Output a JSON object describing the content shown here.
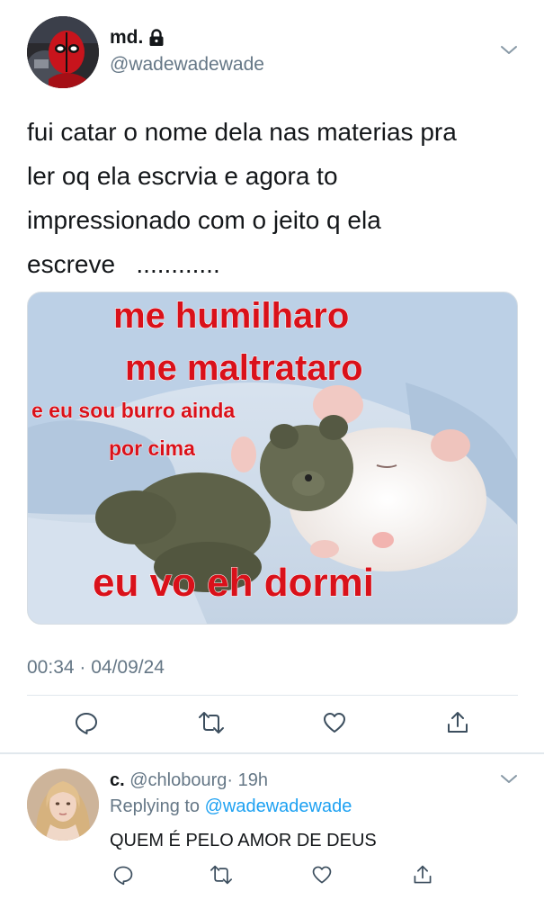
{
  "tweet": {
    "display_name": "md.",
    "handle": "@wadewadewade",
    "text_lines": [
      "fui catar o nome dela nas materias pra",
      "ler oq ela escrvia e agora to",
      "impressionado com o jeito q ela",
      "escreve   ............"
    ],
    "media": {
      "meme_lines": [
        "me humilharo",
        "me maltrataro",
        "e eu sou burro ainda",
        "por cima",
        "eu vo eh dormi"
      ]
    },
    "timestamp": "00:34 · 04/09/24",
    "actions": [
      "reply-icon",
      "retweet-icon",
      "like-icon",
      "share-icon"
    ]
  },
  "reply": {
    "display_name": "c.",
    "handle": "@chlobourg",
    "time": "· 19h",
    "replying_prefix": "Replying to ",
    "replying_to": "@wadewadewade",
    "text": "QUEM É PELO AMOR DE DEUS",
    "actions": [
      "reply-icon",
      "retweet-icon",
      "like-icon",
      "share-icon"
    ]
  },
  "colors": {
    "link": "#1da1f2",
    "secondary_text": "#657786",
    "meme_red": "#d9111a"
  }
}
